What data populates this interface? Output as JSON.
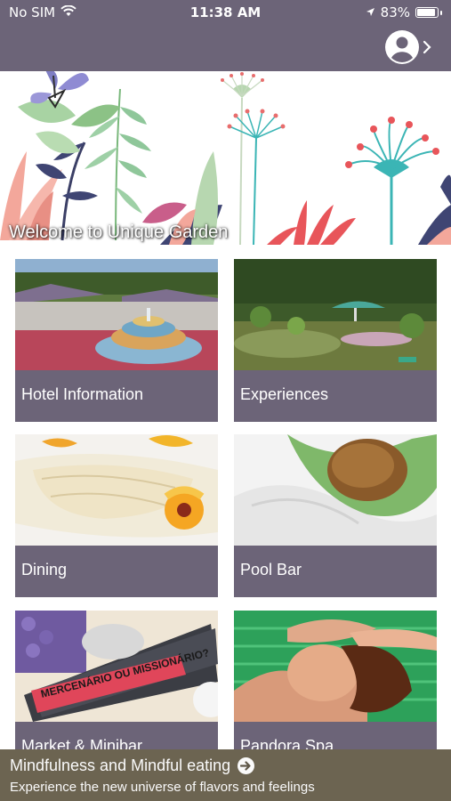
{
  "status_bar": {
    "carrier": "No SIM",
    "time": "11:38 AM",
    "battery_percent": "83%"
  },
  "nav": {
    "profile_icon": "user-circle-icon",
    "chevron_icon": "chevron-right-icon"
  },
  "hero": {
    "title": "Welcome to Unique Garden"
  },
  "cards": [
    {
      "label": "Hotel Information"
    },
    {
      "label": "Experiences"
    },
    {
      "label": "Dining"
    },
    {
      "label": "Pool Bar"
    },
    {
      "label": "Market & Minibar"
    },
    {
      "label": "Pandora Spa"
    }
  ],
  "book_cover_text": "MERCENÁRIO OU MISSIONÁRIO?",
  "banner": {
    "title": "Mindfulness and Mindful eating",
    "subtitle": "Experience the new universe of flavors and feelings"
  },
  "colors": {
    "brand": "#6c6478",
    "banner": "#6c6450"
  }
}
